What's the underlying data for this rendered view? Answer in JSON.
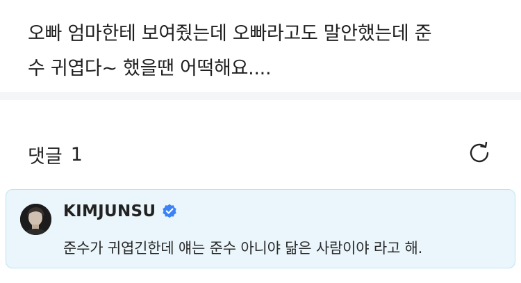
{
  "post": {
    "body_line1": "오빠 엄마한테 보여줬는데 오빠라고도 말안했는데 준",
    "body_line2": "수 귀엽다~ 했을땐 어떡해요...."
  },
  "comments": {
    "title": "댓글",
    "count": "1",
    "refresh_icon": "refresh-icon"
  },
  "comment": {
    "author": "KIMJUNSU",
    "verified_icon": "verified-badge-icon",
    "verified_color": "#3b82f6",
    "text": "준수가 귀엽긴한데 얘는 준수 아니야 닮은 사람이야 라고 해."
  },
  "colors": {
    "card_bg": "#eaf6fb",
    "card_border": "#bfe3ef",
    "divider": "#f4f5f7"
  }
}
